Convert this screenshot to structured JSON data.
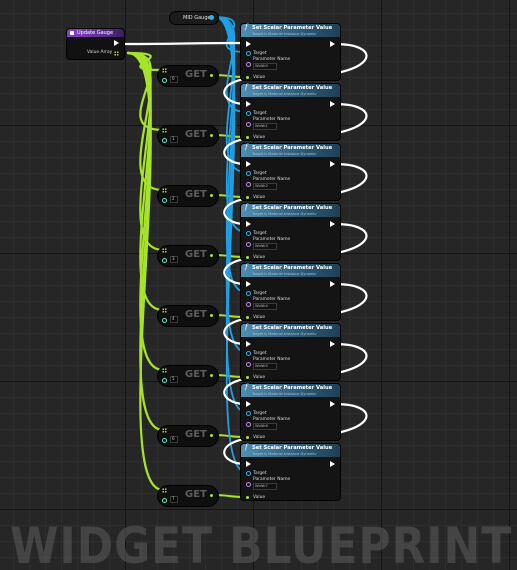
{
  "watermark": "WIDGET BLUEPRINT",
  "event_node": {
    "title": "Update Gauge",
    "output_label": "Value Array"
  },
  "variable_node": {
    "label": "MID Gauge"
  },
  "get_label": "GET",
  "set_label": "Set Scalar Parameter Value",
  "set_subtitle": "Target is Material Instance Dynamic",
  "pin_labels": {
    "target": "Target",
    "param_name": "Parameter Name",
    "value": "Value"
  },
  "set_nodes": [
    {
      "param": "Width0"
    },
    {
      "param": "Width1"
    },
    {
      "param": "Width2"
    },
    {
      "param": "Width3"
    },
    {
      "param": "Width4"
    },
    {
      "param": "Width5"
    },
    {
      "param": "Width6"
    },
    {
      "param": "Width7"
    }
  ],
  "get_nodes": [
    {
      "index": "0"
    },
    {
      "index": "1"
    },
    {
      "index": "2"
    },
    {
      "index": "3"
    },
    {
      "index": "4"
    },
    {
      "index": "5"
    },
    {
      "index": "6"
    },
    {
      "index": "7"
    }
  ],
  "colors": {
    "exec_wire": "#ffffff",
    "object_wire": "#1e9fe6",
    "float_wire": "#a6e32b",
    "func_header": "#4f8fb3",
    "event_header": "#8a3fc9",
    "grid": "#262626"
  }
}
